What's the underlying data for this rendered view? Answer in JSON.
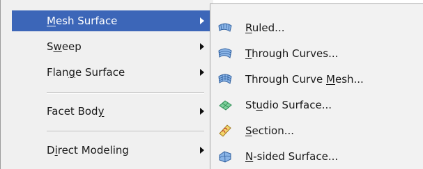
{
  "primary_menu": {
    "items": [
      {
        "label_pre": "",
        "accel": "M",
        "label_post": "esh Surface"
      },
      {
        "label_pre": "S",
        "accel": "w",
        "label_post": "eep"
      },
      {
        "label_pre": "Flan",
        "accel": "g",
        "label_post": "e Surface"
      },
      {
        "label_pre": "Facet Bod",
        "accel": "y",
        "label_post": ""
      },
      {
        "label_pre": "D",
        "accel": "i",
        "label_post": "rect Modeling"
      }
    ]
  },
  "sub_menu": {
    "items": [
      {
        "label_pre": "",
        "accel": "R",
        "label_post": "uled...",
        "icon": "ruled-surface-icon"
      },
      {
        "label_pre": "",
        "accel": "T",
        "label_post": "hrough Curves...",
        "icon": "through-curves-icon"
      },
      {
        "label_pre": "Through Curve ",
        "accel": "M",
        "label_post": "esh...",
        "icon": "through-curve-mesh-icon"
      },
      {
        "label_pre": "St",
        "accel": "u",
        "label_post": "dio Surface...",
        "icon": "studio-surface-icon"
      },
      {
        "label_pre": "",
        "accel": "S",
        "label_post": "ection...",
        "icon": "section-icon"
      },
      {
        "label_pre": "",
        "accel": "N",
        "label_post": "-sided Surface...",
        "icon": "n-sided-surface-icon"
      }
    ]
  },
  "colors": {
    "highlight": "#3c66b8",
    "menu_bg": "#f0f0f0"
  }
}
